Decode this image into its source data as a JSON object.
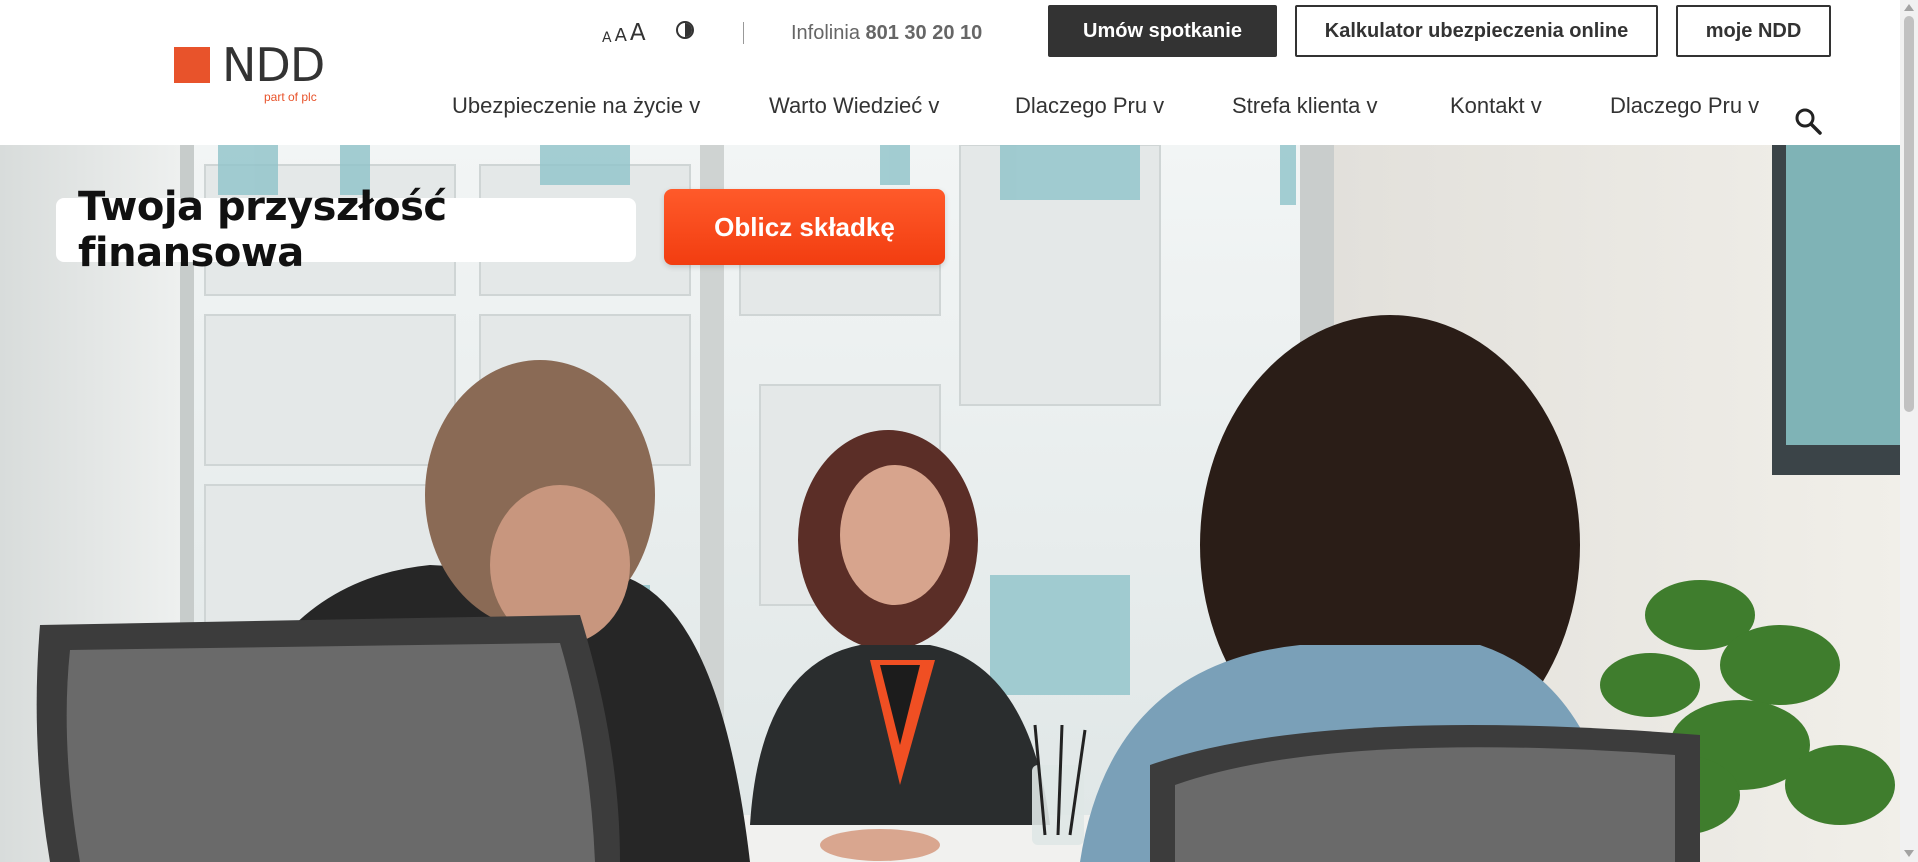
{
  "brand": {
    "logo_text": "NDD",
    "logo_sub": "part of plc",
    "accent_color": "#e8532b"
  },
  "accessibility": {
    "font_small": "A",
    "font_medium": "A",
    "font_large": "A",
    "contrast_icon": "contrast-icon"
  },
  "infolinia": {
    "label": "Infolinia",
    "number": "801 30 20 10"
  },
  "top_buttons": {
    "meeting": "Umów spotkanie",
    "calculator": "Kalkulator ubezpieczenia online",
    "account": "moje NDD"
  },
  "nav": {
    "items": [
      {
        "label": "Ubezpieczenie na życie v"
      },
      {
        "label": "Warto Wiedzieć v"
      },
      {
        "label": "Dlaczego Pru v"
      },
      {
        "label": "Strefa klienta v"
      },
      {
        "label": "Kontakt v"
      },
      {
        "label": "Dlaczego Pru v"
      }
    ],
    "search_icon": "search-icon"
  },
  "hero": {
    "title": "Twoja przyszłość finansowa",
    "cta_label": "Oblicz składkę",
    "cta_color": "#f4481a"
  }
}
